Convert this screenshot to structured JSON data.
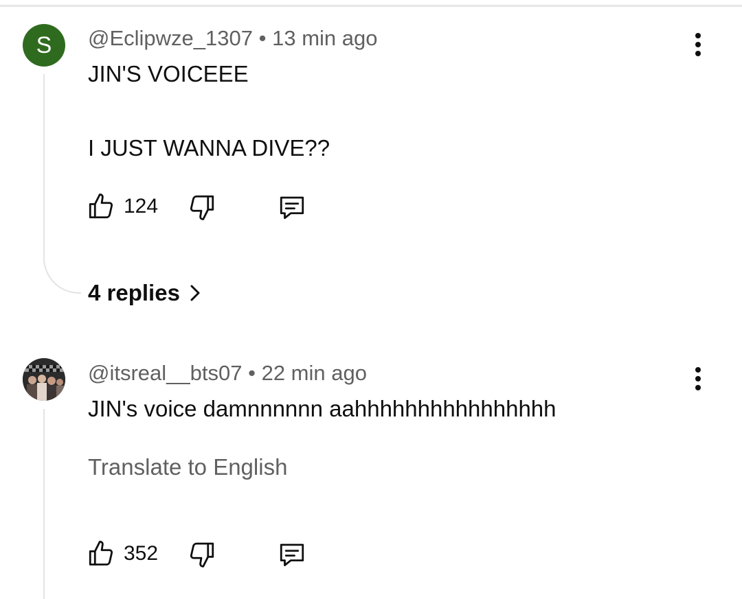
{
  "comments": [
    {
      "avatar_letter": "S",
      "avatar_color": "#2f6b1e",
      "handle": "@Eclipwze_1307",
      "time": "13 min ago",
      "text": "JIN'S VOICEEE\n\nI JUST WANNA DIVE??",
      "likes": "124",
      "replies_label": "4 replies"
    },
    {
      "avatar": "photo",
      "handle": "@itsreal__bts07",
      "time": "22 min ago",
      "text": "JIN's voice damnnnnnn aahhhhhhhhhhhhhhhh",
      "translate_label": "Translate to English",
      "likes": "352"
    }
  ],
  "separator": " • ",
  "icons": [
    "thumbs-up-icon",
    "thumbs-down-icon",
    "reply-icon",
    "more-vertical-icon",
    "chevron-right-icon"
  ]
}
